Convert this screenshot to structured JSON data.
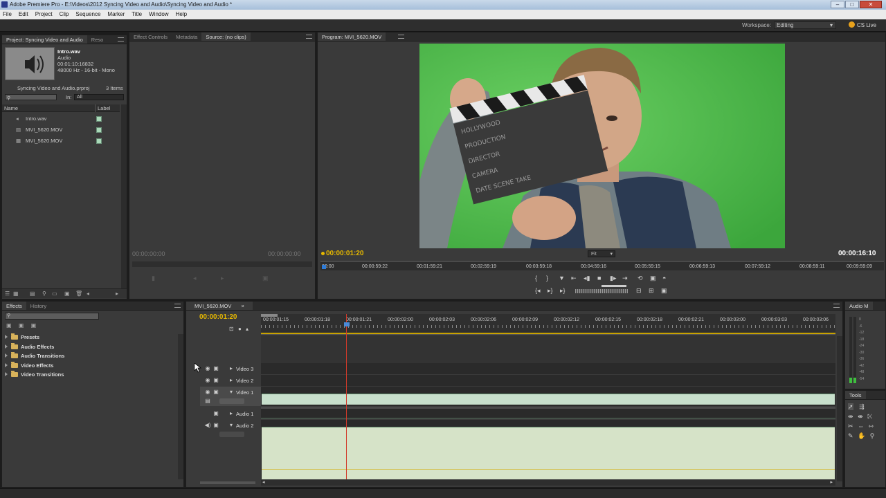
{
  "window": {
    "title": "Adobe Premiere Pro - E:\\Videos\\2012 Syncing Video and Audio\\Syncing Video and Audio *"
  },
  "menu": [
    "File",
    "Edit",
    "Project",
    "Clip",
    "Sequence",
    "Marker",
    "Title",
    "Window",
    "Help"
  ],
  "workspace": {
    "label": "Workspace:",
    "value": "Editing",
    "cs_live": "CS Live"
  },
  "project_panel": {
    "tab": "Project: Syncing Video and Audio",
    "tab2": "Reso",
    "clip_name": "Intro.wav",
    "clip_type": "Audio",
    "clip_duration": "00:01:10:16832",
    "clip_format": "48000 Hz - 16-bit - Mono",
    "project_file": "Syncing Video and Audio.prproj",
    "item_count": "3 Items",
    "in_label": "In:",
    "in_value": "All",
    "col_name": "Name",
    "col_label": "Label",
    "items": [
      {
        "name": "Intro.wav",
        "icon": "audio-clip-icon"
      },
      {
        "name": "MVI_5620.MOV",
        "icon": "av-clip-icon"
      },
      {
        "name": "MVI_5620.MOV",
        "icon": "sequence-icon"
      }
    ]
  },
  "source_panel": {
    "tabs": [
      "Effect Controls",
      "Metadata",
      "Source: (no clips)"
    ],
    "timecode_left": "00:00:00:00",
    "timecode_right": "00:00:00:00"
  },
  "program_panel": {
    "tab": "Program: MVI_5620.MOV",
    "timecode": "00:00:01:20",
    "duration": "00:00:16:10",
    "fit": "Fit",
    "ruler": [
      "00:00",
      "00:00:59:22",
      "00:01:59:21",
      "00:02:59:19",
      "00:03:59:18",
      "00:04:59:16",
      "00:05:59:15",
      "00:06:59:13",
      "00:07:59:12",
      "00:08:59:11",
      "00:09:59:09"
    ],
    "clapper_lines": [
      "HOLLYWOOD",
      "PRODUCTION",
      "DIRECTOR",
      "CAMERA",
      "DATE   SCENE   TAKE"
    ]
  },
  "effects_panel": {
    "tabs": [
      "Effects",
      "History"
    ],
    "items": [
      "Presets",
      "Audio Effects",
      "Audio Transitions",
      "Video Effects",
      "Video Transitions"
    ]
  },
  "timeline": {
    "tab": "MVI_5620.MOV",
    "timecode": "00:00:01:20",
    "ruler": [
      "00:00:01:15",
      "00:00:01:18",
      "00:00:01:21",
      "00:00:02:00",
      "00:00:02:03",
      "00:00:02:06",
      "00:00:02:09",
      "00:00:02:12",
      "00:00:02:15",
      "00:00:02:18",
      "00:00:02:21",
      "00:00:03:00",
      "00:00:03:03",
      "00:00:03:06"
    ],
    "tracks": [
      "Video 3",
      "Video 2",
      "Video 1",
      "Audio 1",
      "Audio 2"
    ]
  },
  "audio_meter": {
    "tab": "Audio M",
    "scale": [
      "0",
      "-6",
      "-12",
      "-18",
      "-24",
      "-30",
      "-36",
      "-42",
      "-48",
      "-54"
    ]
  },
  "tools": {
    "tab": "Tools"
  },
  "colors": {
    "timecode": "#e6b800",
    "clip": "#c8e0cc",
    "playhead": "#d23a2a",
    "greenscreen": "#4fb84a"
  }
}
